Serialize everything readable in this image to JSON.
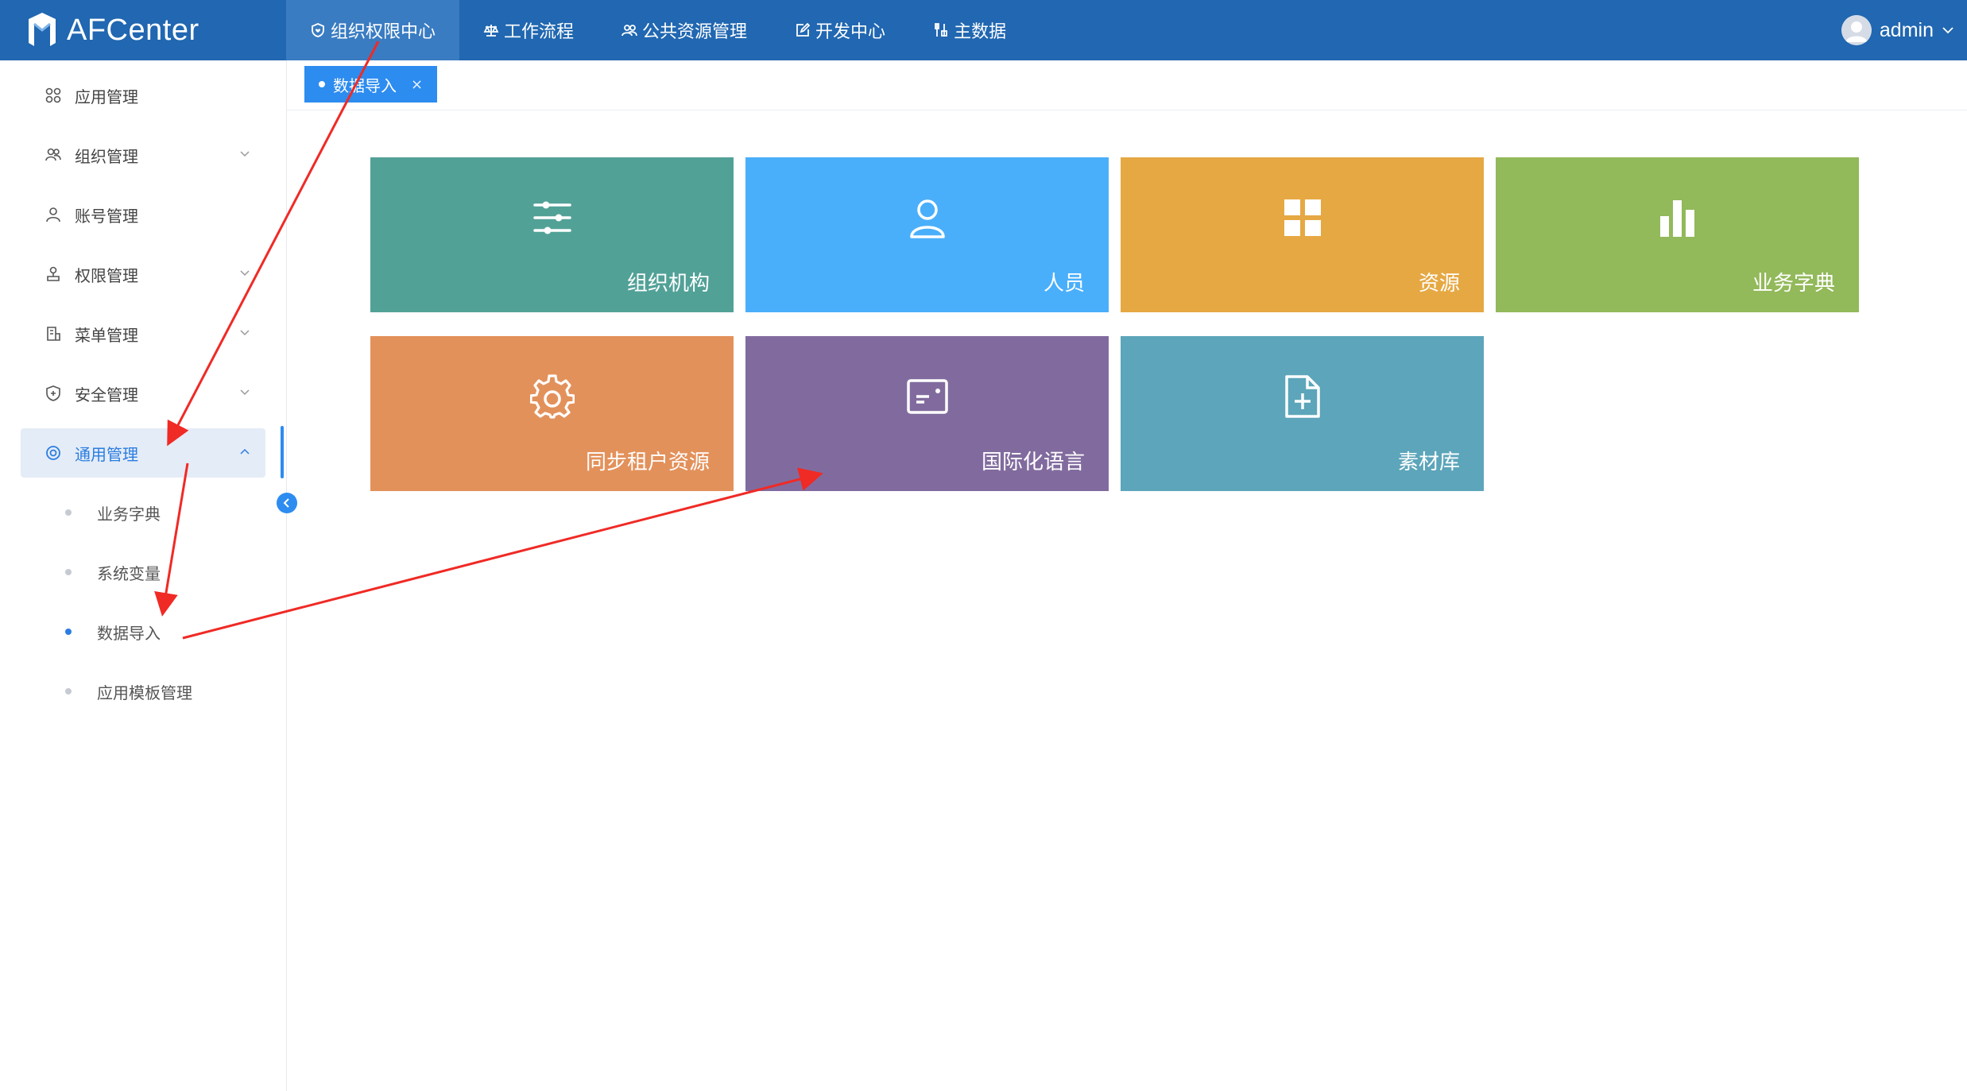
{
  "app": {
    "name": "AFCenter"
  },
  "top_nav": [
    {
      "label": "组织权限中心",
      "icon": "shield-heart-icon",
      "active": true
    },
    {
      "label": "工作流程",
      "icon": "scale-icon"
    },
    {
      "label": "公共资源管理",
      "icon": "users-icon"
    },
    {
      "label": "开发中心",
      "icon": "edit-icon"
    },
    {
      "label": "主数据",
      "icon": "tools-icon"
    }
  ],
  "user": {
    "name": "admin"
  },
  "sidebar": {
    "items": [
      {
        "label": "应用管理",
        "icon": "apps-icon"
      },
      {
        "label": "组织管理",
        "icon": "team-icon",
        "expandable": true
      },
      {
        "label": "账号管理",
        "icon": "user-icon"
      },
      {
        "label": "权限管理",
        "icon": "permission-icon",
        "expandable": true
      },
      {
        "label": "菜单管理",
        "icon": "menu-icon",
        "expandable": true
      },
      {
        "label": "安全管理",
        "icon": "security-icon",
        "expandable": true
      },
      {
        "label": "通用管理",
        "icon": "settings-icon",
        "expandable": true,
        "expanded": true,
        "active": true
      }
    ],
    "sub_items": [
      {
        "label": "业务字典"
      },
      {
        "label": "系统变量"
      },
      {
        "label": "数据导入",
        "active": true
      },
      {
        "label": "应用模板管理"
      }
    ]
  },
  "tabs": [
    {
      "label": "数据导入",
      "close": "×"
    }
  ],
  "tiles": [
    {
      "label": "组织机构",
      "icon": "sliders-icon",
      "color": "#52a197"
    },
    {
      "label": "人员",
      "icon": "person-icon",
      "color": "#4aaffb"
    },
    {
      "label": "资源",
      "icon": "grid-icon",
      "color": "#e6a843"
    },
    {
      "label": "业务字典",
      "icon": "bar-chart-icon",
      "color": "#92b95a"
    },
    {
      "label": "同步租户资源",
      "icon": "gear-icon",
      "color": "#e3915b"
    },
    {
      "label": "国际化语言",
      "icon": "card-icon",
      "color": "#816b9e"
    },
    {
      "label": "素材库",
      "icon": "file-add-icon",
      "color": "#5ca5ba"
    }
  ],
  "colors": {
    "topbar": "#2167b1",
    "accent": "#2d8cf0",
    "annotation": "#f02a25"
  }
}
